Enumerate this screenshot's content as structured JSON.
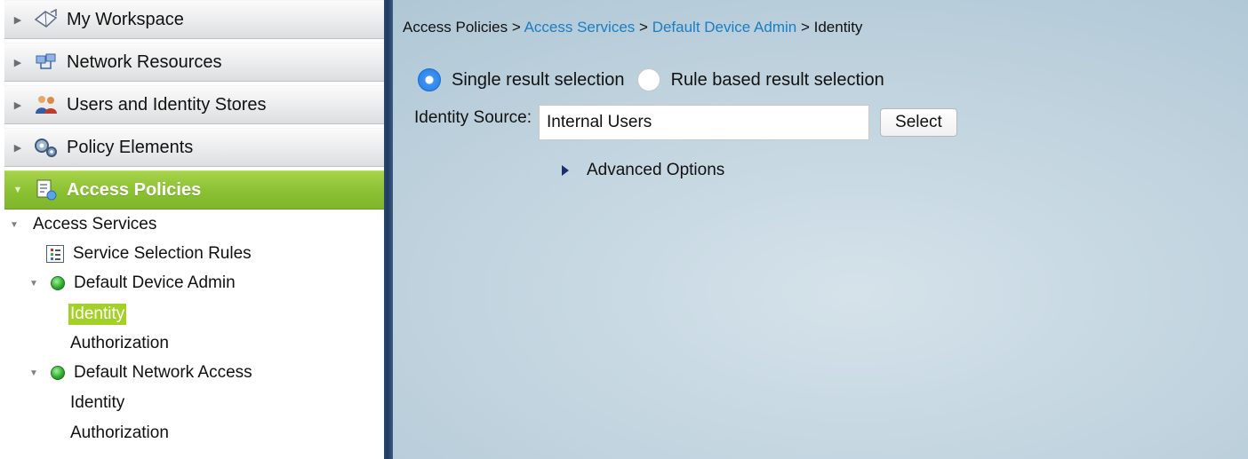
{
  "sidebar": {
    "drawers": [
      {
        "label": "My Workspace",
        "icon": "workspace-icon"
      },
      {
        "label": "Network Resources",
        "icon": "network-resources-icon"
      },
      {
        "label": "Users and Identity Stores",
        "icon": "users-icon"
      },
      {
        "label": "Policy Elements",
        "icon": "policy-elements-icon"
      },
      {
        "label": "Access Policies",
        "icon": "access-policies-icon"
      }
    ],
    "tree": {
      "access_services": "Access Services",
      "service_selection_rules": "Service Selection Rules",
      "default_device_admin": "Default Device Admin",
      "dda_identity": "Identity",
      "dda_authorization": "Authorization",
      "default_network_access": "Default Network Access",
      "dna_identity": "Identity",
      "dna_authorization": "Authorization"
    }
  },
  "breadcrumb": {
    "root": "Access Policies",
    "sep": ">",
    "access_services": "Access Services",
    "default_device_admin": "Default Device Admin",
    "current": "Identity"
  },
  "form": {
    "single_result": "Single result selection",
    "rule_based": "Rule based result selection",
    "identity_source_label": "Identity Source:",
    "identity_source_value": "Internal Users",
    "select_button": "Select",
    "advanced_options": "Advanced Options"
  },
  "colors": {
    "active_drawer": "#8cc233",
    "link": "#1a7ec3",
    "radio_selected": "#2578df",
    "divider": "#1e3a5f"
  }
}
